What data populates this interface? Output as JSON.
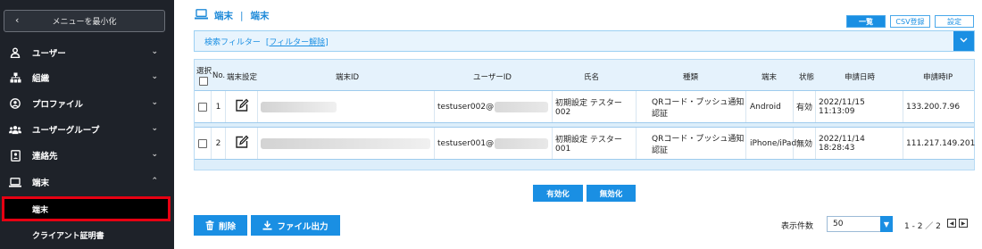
{
  "sidebar": {
    "minimize_label": "メニューを最小化",
    "items": [
      {
        "label": "ユーザー",
        "icon": "user-icon",
        "chevron": "⌄"
      },
      {
        "label": "組織",
        "icon": "org-icon",
        "chevron": "⌄"
      },
      {
        "label": "プロファイル",
        "icon": "profile-icon",
        "chevron": "⌄"
      },
      {
        "label": "ユーザーグループ",
        "icon": "user-group-icon",
        "chevron": "⌄"
      },
      {
        "label": "連絡先",
        "icon": "contact-icon",
        "chevron": "⌄"
      },
      {
        "label": "端末",
        "icon": "device-icon",
        "chevron": "⌃"
      }
    ],
    "subitems": [
      {
        "label": "端末",
        "active": true
      },
      {
        "label": "クライアント証明書",
        "active": false
      }
    ]
  },
  "header": {
    "section": "端末",
    "page": "端末",
    "tabs": [
      "一覧",
      "CSV登録",
      "設定"
    ]
  },
  "filter": {
    "label": "検索フィルター",
    "clear_link": "[フィルター解除]"
  },
  "table": {
    "headers": {
      "select": "選択",
      "no": "No.",
      "device_settings": "端末設定",
      "device_id": "端末ID",
      "user_id": "ユーザーID",
      "name": "氏名",
      "type": "種類",
      "device": "端末",
      "status": "状態",
      "applied_at": "申請日時",
      "applied_ip": "申請時IP"
    },
    "rows": [
      {
        "no": "1",
        "user_id": "testuser002@",
        "name": "初期設定 テスター002",
        "type": "QRコード・プッシュ通知認証",
        "device": "Android",
        "status": "有効",
        "applied_at": "2022/11/15 11:13:09",
        "applied_ip": "133.200.7.96"
      },
      {
        "no": "2",
        "user_id": "testuser001@",
        "name": "初期設定 テスター001",
        "type": "QRコード・プッシュ通知認証",
        "device": "iPhone/iPad",
        "status": "無効",
        "applied_at": "2022/11/14 18:28:43",
        "applied_ip": "111.217.149.201"
      }
    ]
  },
  "actions": {
    "enable": "有効化",
    "disable": "無効化"
  },
  "footer": {
    "delete": "削除",
    "export": "ファイル出力",
    "per_page_label": "表示件数",
    "per_page_value": "50",
    "page_info": "1 - 2 ／ 2"
  },
  "colors": {
    "accent": "#1a8fe3",
    "sidebar_bg": "#1e2229",
    "active_border": "#e60012"
  }
}
